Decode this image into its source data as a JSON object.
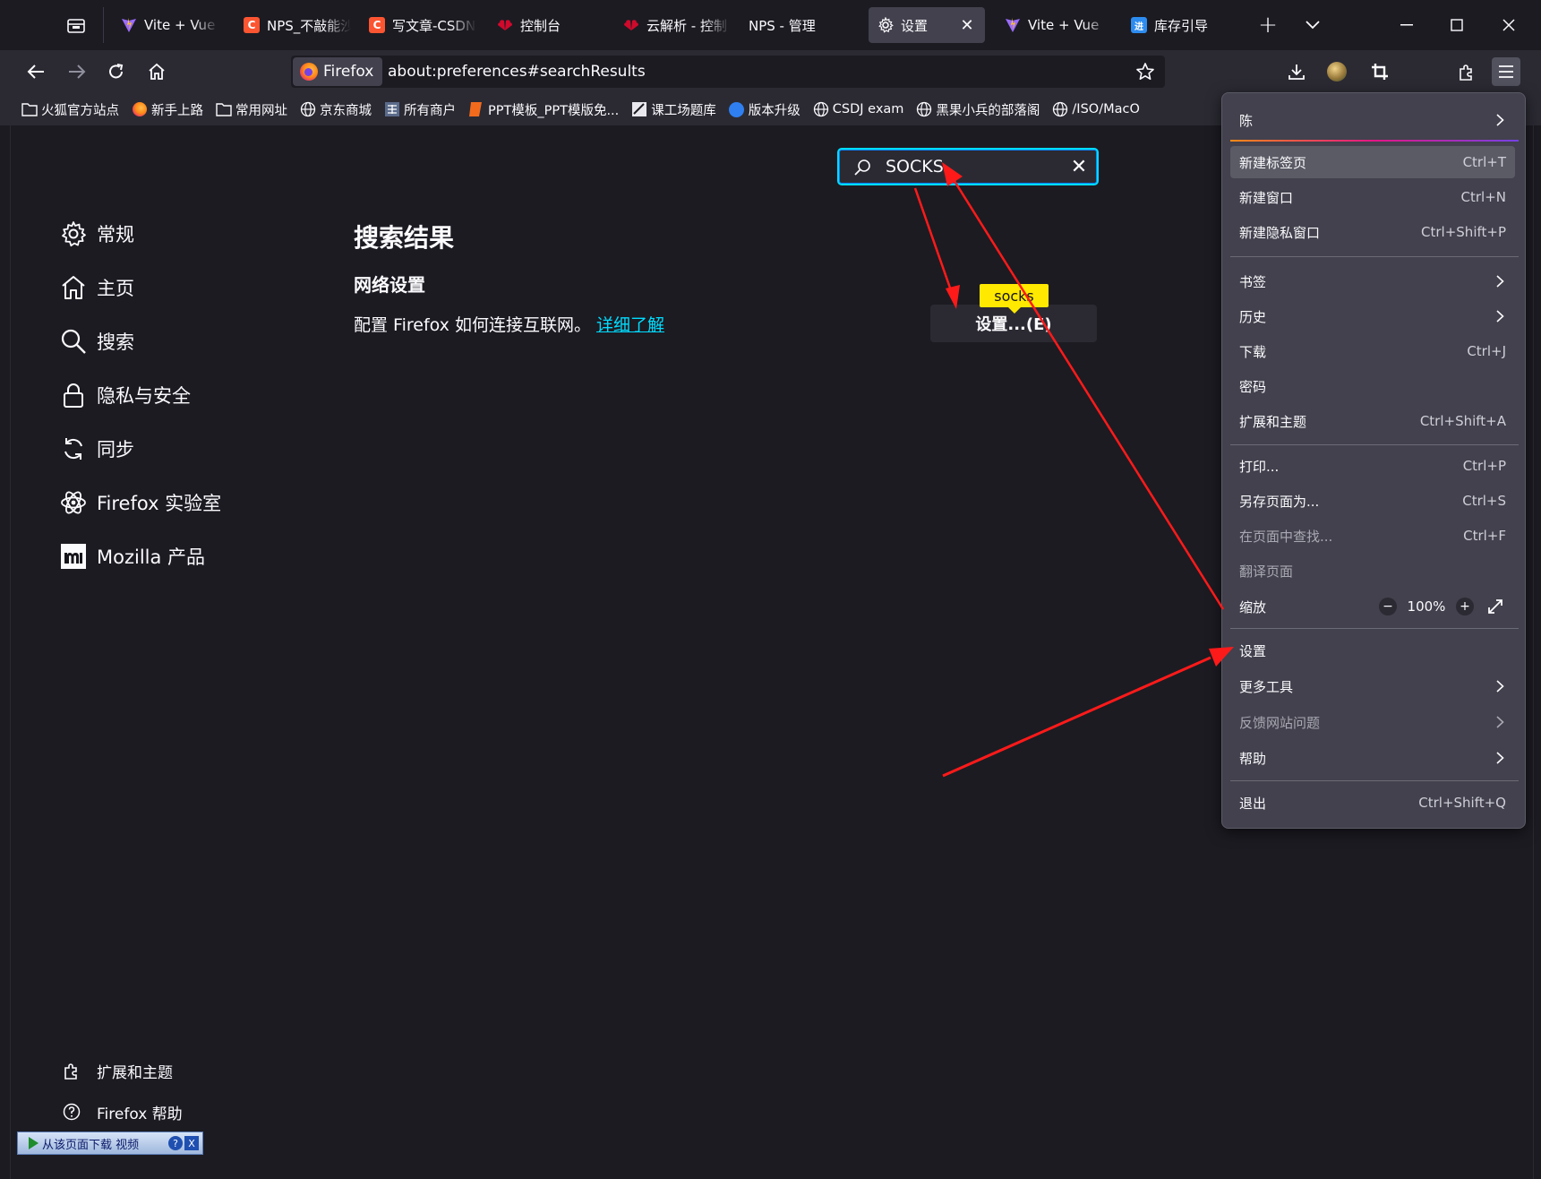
{
  "tabs": [
    {
      "title": "Vite + Vue",
      "icon": "vite-icon"
    },
    {
      "title": "NPS_不敲能沙",
      "icon": "csdn-icon"
    },
    {
      "title": "写文章-CSDN",
      "icon": "csdn-icon"
    },
    {
      "title": "控制台",
      "icon": "huawei-icon"
    },
    {
      "title": "云解析 - 控制",
      "icon": "huawei-icon"
    },
    {
      "title": "NPS - 管理",
      "icon": ""
    },
    {
      "title": "设置",
      "icon": "gear-icon",
      "active": true
    },
    {
      "title": "Vite + Vue",
      "icon": "vite-icon"
    },
    {
      "title": "库存引导",
      "icon": "app-icon"
    }
  ],
  "navbar": {
    "identity_label": "Firefox",
    "url": "about:preferences#searchResults"
  },
  "bookmarks": [
    {
      "label": "火狐官方站点",
      "icon": "folder-icon"
    },
    {
      "label": "新手上路",
      "icon": "firefox-icon"
    },
    {
      "label": "常用网址",
      "icon": "folder-icon"
    },
    {
      "label": "京东商城",
      "icon": "globe-icon"
    },
    {
      "label": "所有商户",
      "icon": "grid-icon"
    },
    {
      "label": "PPT模板_PPT模版免...",
      "icon": "ppt-icon"
    },
    {
      "label": "课工场题库",
      "icon": "doc-icon"
    },
    {
      "label": "版本升级",
      "icon": "app-icon"
    },
    {
      "label": "CSDJ exam",
      "icon": "globe-icon"
    },
    {
      "label": "黑果小兵的部落阁",
      "icon": "globe-icon"
    },
    {
      "label": "/ISO/MacO",
      "icon": "globe-icon"
    }
  ],
  "prefs": {
    "search_value": "SOCKS",
    "categories": [
      "常规",
      "主页",
      "搜索",
      "隐私与安全",
      "同步",
      "Firefox 实验室",
      "Mozilla 产品"
    ],
    "results_heading": "搜索结果",
    "network_heading": "网络设置",
    "network_desc": "配置 Firefox 如何连接互联网。",
    "learn_more": "详细了解",
    "settings_button": "设置...(E)",
    "highlight_tip": "socks",
    "footer_extensions": "扩展和主题",
    "footer_help": "Firefox 帮助",
    "download_bar": "从该页面下载 视频",
    "download_help": "?",
    "download_close": "X"
  },
  "appmenu": {
    "profile": "陈",
    "items": {
      "new_tab": {
        "label": "新建标签页",
        "shortcut": "Ctrl+T"
      },
      "new_window": {
        "label": "新建窗口",
        "shortcut": "Ctrl+N"
      },
      "new_private": {
        "label": "新建隐私窗口",
        "shortcut": "Ctrl+Shift+P"
      },
      "bookmarks": {
        "label": "书签"
      },
      "history": {
        "label": "历史"
      },
      "downloads": {
        "label": "下载",
        "shortcut": "Ctrl+J"
      },
      "passwords": {
        "label": "密码"
      },
      "addons": {
        "label": "扩展和主题",
        "shortcut": "Ctrl+Shift+A"
      },
      "print": {
        "label": "打印...",
        "shortcut": "Ctrl+P"
      },
      "save_page": {
        "label": "另存页面为...",
        "shortcut": "Ctrl+S"
      },
      "find": {
        "label": "在页面中查找...",
        "shortcut": "Ctrl+F"
      },
      "translate": {
        "label": "翻译页面"
      },
      "zoom": {
        "label": "缩放",
        "value": "100%",
        "minus": "−",
        "plus": "+"
      },
      "settings": {
        "label": "设置"
      },
      "more_tools": {
        "label": "更多工具"
      },
      "report": {
        "label": "反馈网站问题"
      },
      "help": {
        "label": "帮助"
      },
      "quit": {
        "label": "退出",
        "shortcut": "Ctrl+Shift+Q"
      }
    }
  },
  "colors": {
    "accent": "#00ddff",
    "highlight": "#ffe900",
    "annotation": "#ff1a1a"
  }
}
